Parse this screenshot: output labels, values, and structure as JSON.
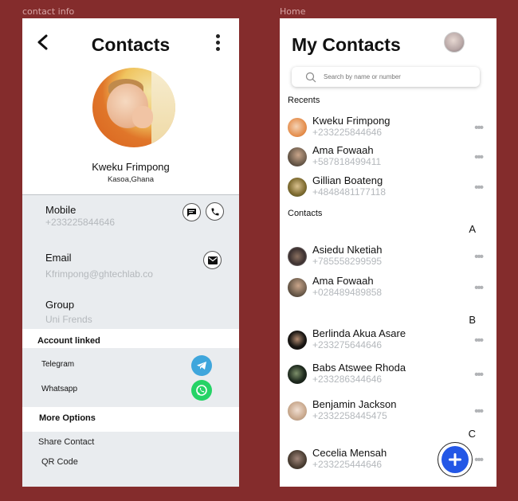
{
  "frames": {
    "left_label": "contact info",
    "right_label": "Home"
  },
  "contact_info": {
    "title": "Contacts",
    "name": "Kweku Frimpong",
    "location": "Kasoa,Ghana",
    "mobile_label": "Mobile",
    "mobile_value": "+233225844646",
    "email_label": "Email",
    "email_value": "Kfrimpong@ghtechlab.co",
    "group_label": "Group",
    "group_value": "Uni Frends",
    "account_linked_title": "Account linked",
    "telegram_label": "Telegram",
    "whatsapp_label": "Whatsapp",
    "more_options_title": "More Options",
    "share_contact": "Share Contact",
    "qr_code": "QR Code",
    "icons": [
      "back-arrow-icon",
      "more-vertical-icon",
      "message-icon",
      "phone-icon",
      "mail-icon",
      "telegram-icon",
      "whatsapp-icon"
    ],
    "colors": {
      "telegram": "#3fa6dc",
      "whatsapp": "#25d366"
    }
  },
  "home": {
    "title": "My Contacts",
    "search_placeholder": "Search by name or number",
    "recents_title": "Recents",
    "recents": [
      {
        "name": "Kweku Frimpong",
        "phone": "+233225844646",
        "avatar_color": "#e48c4a"
      },
      {
        "name": "Ama Fowaah",
        "phone": "+587818499411",
        "avatar_color": "#6a5a4a"
      },
      {
        "name": "Gillian Boateng",
        "phone": "+4848481177118",
        "avatar_color": "#7d6a2f"
      }
    ],
    "contacts_title": "Contacts",
    "letters": {
      "a": "A",
      "b": "B",
      "c": "C"
    },
    "contacts": [
      {
        "name": "Asiedu Nketiah",
        "phone": "+785558299595",
        "avatar_color": "#3a2f2f"
      },
      {
        "name": "Ama Fowaah",
        "phone": "+028489489858",
        "avatar_color": "#6a5a4a"
      },
      {
        "name": "Berlinda Akua Asare",
        "phone": "+233275644646",
        "avatar_color": "#1a1714"
      },
      {
        "name": "Babs Atswee Rhoda",
        "phone": "+233286344646",
        "avatar_color": "#1e2a1e"
      },
      {
        "name": "Benjamin Jackson",
        "phone": "+2332258445475",
        "avatar_color": "#c9a98e"
      },
      {
        "name": "Cecelia Mensah",
        "phone": "+233225444646",
        "avatar_color": "#4a3d32"
      }
    ],
    "more_symbol": "•••",
    "colors": {
      "fab": "#2357e6"
    }
  }
}
